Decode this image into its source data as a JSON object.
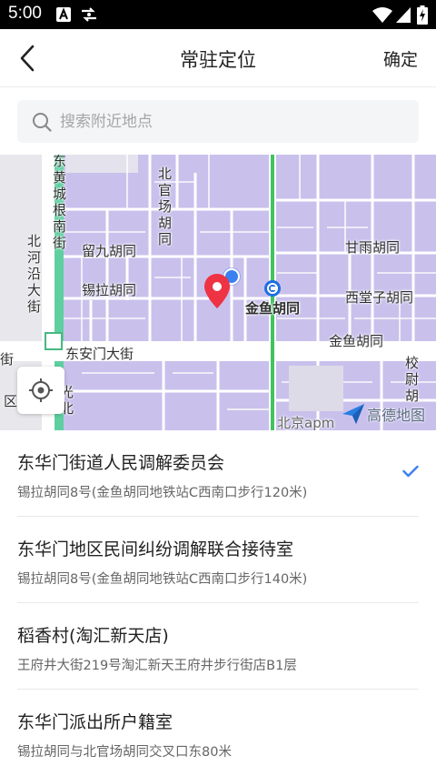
{
  "status_bar": {
    "time": "5:00"
  },
  "nav": {
    "title": "常驻定位",
    "confirm": "确定"
  },
  "search": {
    "placeholder": "搜索附近地点"
  },
  "map": {
    "labels": {
      "beiguanchang": "北官场胡同",
      "dongcheng_jie": "东黄城根南街",
      "beiheyan": "北河沿大街",
      "liujiu": "留九胡同",
      "xila": "锡拉胡同",
      "ganyu": "甘雨胡同",
      "jinyu_metro": "金鱼胡同",
      "xitangzi": "西堂子胡同",
      "dongan": "东安门大街",
      "jinyu": "金鱼胡同",
      "xiaowei": "校尉胡",
      "jie": "街",
      "qu": "区",
      "guangbei": "光北",
      "beijing_apm": "北京apm"
    },
    "logo": "高德地图"
  },
  "places": [
    {
      "name": "东华门街道人民调解委员会",
      "address": "锡拉胡同8号(金鱼胡同地铁站C西南口步行120米)",
      "selected": true
    },
    {
      "name": "东华门地区民间纠纷调解联合接待室",
      "address": "锡拉胡同8号(金鱼胡同地铁站C西南口步行140米)",
      "selected": false
    },
    {
      "name": "稻香村(淘汇新天店)",
      "address": "王府井大街219号淘汇新天王府井步行街店B1层",
      "selected": false
    },
    {
      "name": "东华门派出所户籍室",
      "address": "锡拉胡同与北官场胡同交叉口东80米",
      "selected": false
    }
  ],
  "colors": {
    "accent": "#3b80f0",
    "pin": "#ee3344",
    "map_block": "#c8c0eb",
    "metro_line": "#43c35f"
  }
}
